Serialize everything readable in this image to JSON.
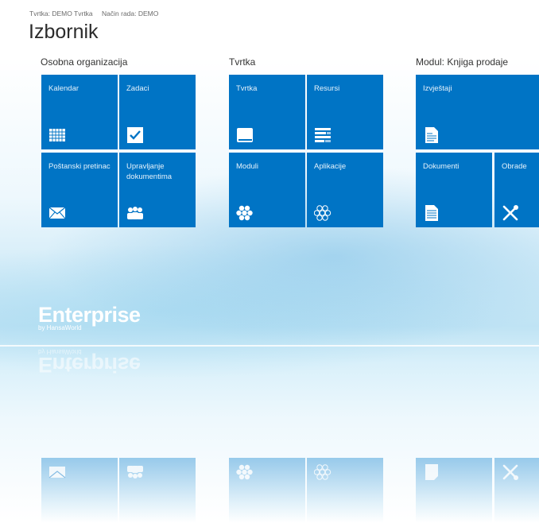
{
  "context": {
    "company": "Tvrtka: DEMO Tvrtka",
    "mode": "Način rada: DEMO"
  },
  "page_title": "Izbornik",
  "groups": [
    {
      "title": "Osobna organizacija",
      "tiles": [
        {
          "label": "Kalendar",
          "icon": "calendar-icon"
        },
        {
          "label": "Zadaci",
          "icon": "checkbox-icon"
        },
        {
          "label": "Poštanski pretinac",
          "icon": "envelope-icon"
        },
        {
          "label": "Upravljanje dokumentima",
          "icon": "people-icon"
        }
      ]
    },
    {
      "title": "Tvrtka",
      "tiles": [
        {
          "label": "Tvrtka",
          "icon": "book-icon"
        },
        {
          "label": "Resursi",
          "icon": "list-icon"
        },
        {
          "label": "Moduli",
          "icon": "hexagons-filled-icon"
        },
        {
          "label": "Aplikacije",
          "icon": "hexagons-outline-icon"
        }
      ]
    },
    {
      "title": "Modul: Knjiga prodaje",
      "tiles": [
        {
          "label": "Izvještaji",
          "icon": "report-icon"
        },
        {
          "label": "Dokumenti",
          "icon": "document-icon"
        },
        {
          "label": "Obrade",
          "icon": "tools-icon"
        }
      ]
    }
  ],
  "logo": {
    "name": "Enterprise",
    "byline": "by HansaWorld"
  },
  "colors": {
    "tile": "#0074c5",
    "title_text": "#2b2b2b"
  }
}
